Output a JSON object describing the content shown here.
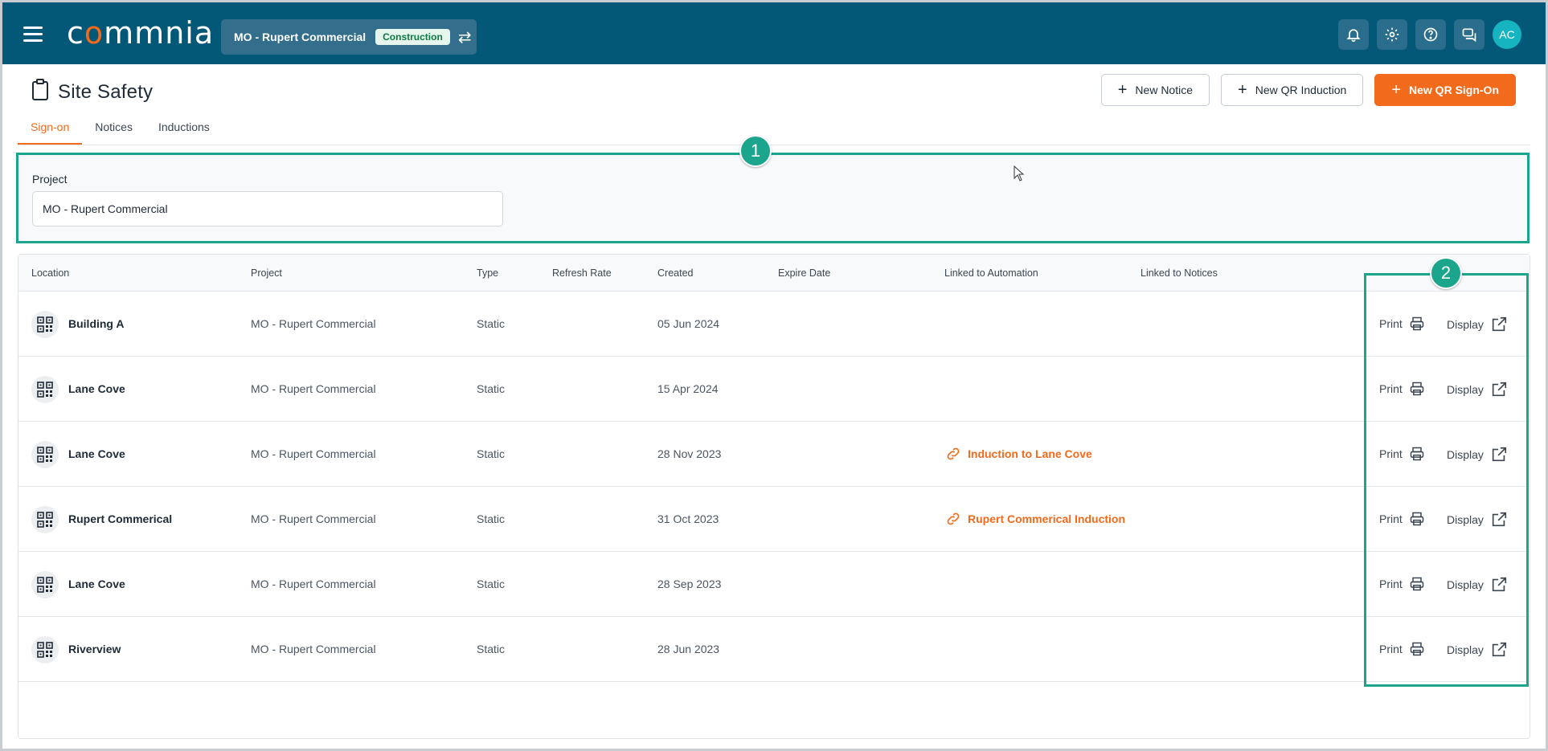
{
  "header": {
    "logo_text": "commnia",
    "project_name": "MO - Rupert Commercial",
    "project_badge": "Construction",
    "avatar_initials": "AC"
  },
  "page": {
    "title": "Site Safety",
    "buttons": {
      "new_notice": "New Notice",
      "new_qr_induction": "New QR Induction",
      "new_qr_signon": "New QR Sign-On"
    },
    "tabs": [
      "Sign-on",
      "Notices",
      "Inductions"
    ]
  },
  "filter": {
    "label": "Project",
    "value": "MO - Rupert Commercial"
  },
  "markers": {
    "m1": "1",
    "m2": "2"
  },
  "table": {
    "columns": [
      "Location",
      "Project",
      "Type",
      "Refresh Rate",
      "Created",
      "Expire Date",
      "Linked to Automation",
      "Linked to Notices"
    ],
    "print_label": "Print",
    "display_label": "Display",
    "rows": [
      {
        "location": "Building A",
        "project": "MO - Rupert Commercial",
        "type": "Static",
        "created": "05 Jun 2024",
        "automation": ""
      },
      {
        "location": "Lane Cove",
        "project": "MO - Rupert Commercial",
        "type": "Static",
        "created": "15 Apr 2024",
        "automation": ""
      },
      {
        "location": "Lane Cove",
        "project": "MO - Rupert Commercial",
        "type": "Static",
        "created": "28 Nov 2023",
        "automation": "Induction to Lane Cove"
      },
      {
        "location": "Rupert Commerical",
        "project": "MO - Rupert Commercial",
        "type": "Static",
        "created": "31 Oct 2023",
        "automation": "Rupert Commerical Induction"
      },
      {
        "location": "Lane Cove",
        "project": "MO - Rupert Commercial",
        "type": "Static",
        "created": "28 Sep 2023",
        "automation": ""
      },
      {
        "location": "Riverview",
        "project": "MO - Rupert Commercial",
        "type": "Static",
        "created": "28 Jun 2023",
        "automation": ""
      }
    ]
  },
  "colors": {
    "topbar": "#045877",
    "accent": "#f26a1b",
    "highlight": "#1aa58c"
  }
}
